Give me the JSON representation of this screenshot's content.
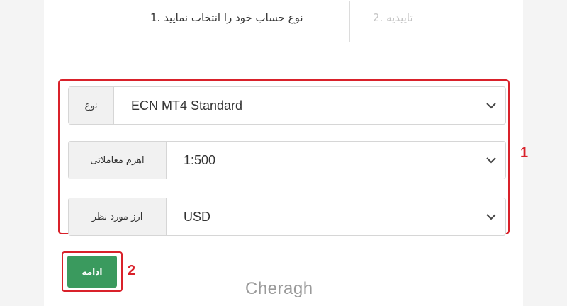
{
  "steps": {
    "step1_label": "نوع حساب خود را انتخاب نمایید .1",
    "step2_label": "تاییدیه .2"
  },
  "form": {
    "type": {
      "label": "نوع",
      "value": "ECN MT4 Standard"
    },
    "leverage": {
      "label": "اهرم معاملاتی",
      "value": "1:500"
    },
    "currency": {
      "label": "ارز مورد نظر",
      "value": "USD"
    }
  },
  "actions": {
    "continue_label": "ادامه"
  },
  "annotations": {
    "callout_1": "1",
    "callout_2": "2"
  },
  "branding": {
    "watermark": "Cheragh"
  },
  "colors": {
    "highlight": "#d9212a",
    "button": "#3a9a5e"
  },
  "icons": {
    "select_arrow": "chevron-down-icon"
  }
}
